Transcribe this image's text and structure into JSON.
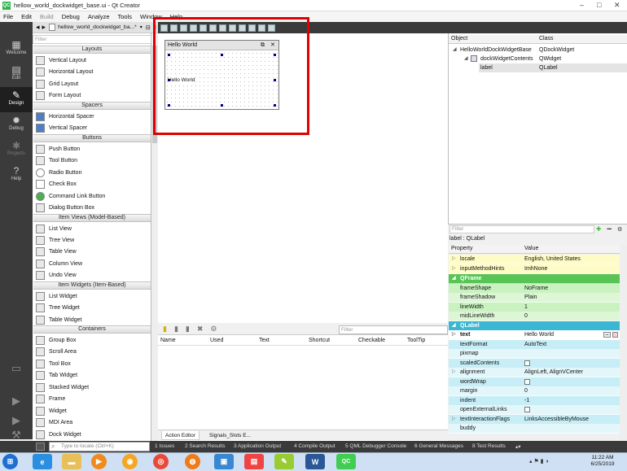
{
  "window": {
    "title": "hellow_world_dockwidget_base.ui - Qt Creator",
    "app_icon": "QC"
  },
  "menu": [
    "File",
    "Edit",
    "Build",
    "Debug",
    "Analyze",
    "Tools",
    "Window",
    "Help"
  ],
  "modes": [
    {
      "label": "Welcome",
      "icon": "grid-icon"
    },
    {
      "label": "Edit",
      "icon": "document-icon"
    },
    {
      "label": "Design",
      "icon": "pencil-icon"
    },
    {
      "label": "Debug",
      "icon": "bug-icon"
    },
    {
      "label": "Projects",
      "icon": "wrench-icon"
    },
    {
      "label": "Help",
      "icon": "question-icon"
    }
  ],
  "file_tab": {
    "name": "hellow_world_dockwidget_ba...*",
    "close": "×"
  },
  "widget_box": {
    "filter_placeholder": "Filter",
    "categories": {
      "layouts": "Layouts",
      "spacers": "Spacers",
      "buttons": "Buttons",
      "item_views": "Item Views (Model-Based)",
      "item_widgets": "Item Widgets (Item-Based)",
      "containers": "Containers"
    },
    "items": {
      "vertical_layout": "Vertical Layout",
      "horizontal_layout": "Horizontal Layout",
      "grid_layout": "Grid Layout",
      "form_layout": "Form Layout",
      "horizontal_spacer": "Horizontal Spacer",
      "vertical_spacer": "Vertical Spacer",
      "push_button": "Push Button",
      "tool_button": "Tool Button",
      "radio_button": "Radio Button",
      "check_box": "Check Box",
      "command_link_button": "Command Link Button",
      "dialog_button_box": "Dialog Button Box",
      "list_view": "List View",
      "tree_view": "Tree View",
      "table_view": "Table View",
      "column_view": "Column View",
      "undo_view": "Undo View",
      "list_widget": "List Widget",
      "tree_widget": "Tree Widget",
      "table_widget": "Table Widget",
      "group_box": "Group Box",
      "scroll_area": "Scroll Area",
      "tool_box": "Tool Box",
      "tab_widget": "Tab Widget",
      "stacked_widget": "Stacked Widget",
      "frame": "Frame",
      "widget": "Widget",
      "mdi_area": "MDI Area",
      "dock_widget": "Dock Widget"
    }
  },
  "form": {
    "dock_title": "Hello World",
    "float_btn": "⧉",
    "close_btn": "✕",
    "label_text": "Hello World"
  },
  "action_editor": {
    "filter_placeholder": "Filter",
    "columns": [
      "Name",
      "Used",
      "Text",
      "Shortcut",
      "Checkable",
      "ToolTip"
    ],
    "tabs": [
      "Action Editor",
      "Signals_Slots E..."
    ]
  },
  "object_inspector": {
    "columns": [
      "Object",
      "Class"
    ],
    "rows": [
      {
        "object": "HelloWorldDockWidgetBase",
        "class": "QDockWidget"
      },
      {
        "object": "dockWidgetContents",
        "class": "QWidget"
      },
      {
        "object": "label",
        "class": "QLabel"
      }
    ]
  },
  "property_editor": {
    "filter_placeholder": "Filter",
    "selected": "label : QLabel",
    "columns": [
      "Property",
      "Value"
    ],
    "rows": {
      "locale": {
        "name": "locale",
        "value": "English, United States"
      },
      "imh": {
        "name": "inputMethodHints",
        "value": "ImhNone"
      },
      "qframe": {
        "name": "QFrame"
      },
      "frameShape": {
        "name": "frameShape",
        "value": "NoFrame"
      },
      "frameShadow": {
        "name": "frameShadow",
        "value": "Plain"
      },
      "lineWidth": {
        "name": "lineWidth",
        "value": "1"
      },
      "midLineWidth": {
        "name": "midLineWidth",
        "value": "0"
      },
      "qlabel": {
        "name": "QLabel"
      },
      "text": {
        "name": "text",
        "value": "Hello World"
      },
      "textFormat": {
        "name": "textFormat",
        "value": "AutoText"
      },
      "pixmap": {
        "name": "pixmap",
        "value": ""
      },
      "scaledContents": {
        "name": "scaledContents"
      },
      "alignment": {
        "name": "alignment",
        "value": "AlignLeft, AlignVCenter"
      },
      "wordWrap": {
        "name": "wordWrap"
      },
      "margin": {
        "name": "margin",
        "value": "0"
      },
      "indent": {
        "name": "indent",
        "value": "-1"
      },
      "openExternalLinks": {
        "name": "openExternalLinks"
      },
      "tif": {
        "name": "textInteractionFlags",
        "value": "LinksAccessibleByMouse"
      },
      "buddy": {
        "name": "buddy",
        "value": ""
      }
    }
  },
  "status_bar": {
    "locator_placeholder": "Type to locate (Ctrl+K)",
    "panes": [
      "1 Issues",
      "2 Search Results",
      "3 Application Output",
      "4 Compile Output",
      "5 QML Debugger Console",
      "6 General Messages",
      "8 Test Results"
    ]
  },
  "taskbar": {
    "time": "11:22 AM",
    "date": "6/25/2019",
    "word_label": "W",
    "qc_label": "QC"
  },
  "colors": {
    "design_mode_bg": "#1f1f1f",
    "highlight_red": "#e00000",
    "prop_yellow": "#fefbc6",
    "prop_green": "#c9f2c0",
    "prop_cyan": "#c7eef6"
  }
}
